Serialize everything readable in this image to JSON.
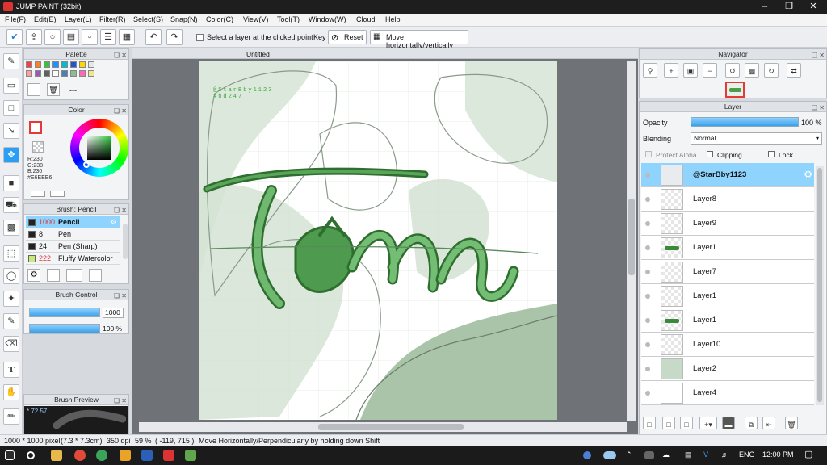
{
  "app": {
    "title": "JUMP PAINT (32bit)"
  },
  "menu": [
    "File(F)",
    "Edit(E)",
    "Layer(L)",
    "Filter(R)",
    "Select(S)",
    "Snap(N)",
    "Color(C)",
    "View(V)",
    "Tool(T)",
    "Window(W)",
    "Cloud",
    "Help"
  ],
  "toolbar": {
    "select_layer_label": "Select a layer at the clicked point",
    "key_label": "Key",
    "reset_label": "Reset",
    "move_label": "Move horizontally/vertically"
  },
  "palette": {
    "title": "Palette",
    "placeholder": "---",
    "swatches": [
      "#ff3b3b",
      "#ff7f2a",
      "#3fbf3f",
      "#1e90ff",
      "#00bcd4",
      "#2255cc",
      "#ffd700",
      "#e6e6e6",
      "#ffa0a0",
      "#9b59b6",
      "#606060",
      "#ffffff",
      "#4682b4",
      "#8fbc8f",
      "#ff69b4",
      "#f0e68c"
    ]
  },
  "color": {
    "title": "Color",
    "r": "R:230",
    "g": "G:238",
    "b": "B:230",
    "hex": "#E6EEE6"
  },
  "brush": {
    "title": "Brush: Pencil",
    "items": [
      {
        "size": "1000",
        "name": "Pencil",
        "swatch": "#222222"
      },
      {
        "size": "8",
        "name": "Pen",
        "swatch": "#222222"
      },
      {
        "size": "24",
        "name": "Pen (Sharp)",
        "swatch": "#222222"
      },
      {
        "size": "222",
        "name": "Fluffy Watercolor",
        "swatch": "#c9e97b"
      }
    ]
  },
  "brush_control": {
    "title": "Brush Control",
    "size": "1000",
    "opacity": "100 %",
    "size_fill": 1.0,
    "opacity_fill": 1.0
  },
  "brush_preview": {
    "title": "Brush Preview",
    "value": "* 72.57"
  },
  "canvas": {
    "tab": "Untitled",
    "watermark_line1": "@StarBby1123",
    "watermark_line2": "#hd247"
  },
  "navigator": {
    "title": "Navigator"
  },
  "layer_panel": {
    "title": "Layer",
    "opacity_label": "Opacity",
    "opacity_value": "100 %",
    "blending_label": "Blending",
    "blending_value": "Normal",
    "protect_alpha": "Protect Alpha",
    "clipping": "Clipping",
    "lock": "Lock",
    "layers": [
      {
        "name": "@StarBby1123",
        "selected": true
      },
      {
        "name": "Layer8"
      },
      {
        "name": "Layer9"
      },
      {
        "name": "Layer1"
      },
      {
        "name": "Layer7"
      },
      {
        "name": "Layer1"
      },
      {
        "name": "Layer1"
      },
      {
        "name": "Layer10"
      },
      {
        "name": "Layer2"
      },
      {
        "name": "Layer4"
      }
    ]
  },
  "status": {
    "pixels": "1000 * 1000 pixel",
    "size": "(7.3 * 7.3cm)",
    "dpi": "350 dpi",
    "zoom": "59 %",
    "coords": "( -119, 715 )",
    "hint": "Move Horizontally/Perpendicularly by holding down Shift"
  },
  "taskbar": {
    "lang": "ENG",
    "time": "12:00 PM"
  }
}
